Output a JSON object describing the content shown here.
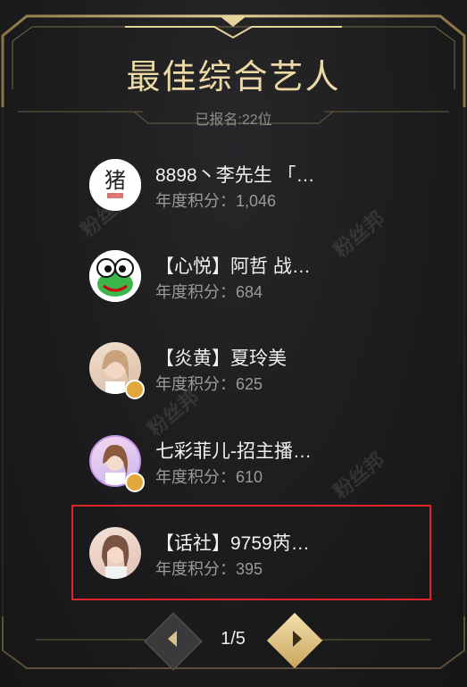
{
  "header": {
    "title": "最佳综合艺人",
    "registered": "已报名:22位"
  },
  "score_label": "年度积分：",
  "artists": [
    {
      "name": "8898丶李先生 「…",
      "score": "1,046",
      "avatar": "avatar-pig-logo"
    },
    {
      "name": "【心悦】阿哲 战…",
      "score": "684",
      "avatar": "avatar-frog"
    },
    {
      "name": "【炎黄】夏玲美",
      "score": "625",
      "avatar": "avatar-woman",
      "badge": true
    },
    {
      "name": "七彩菲儿-招主播…",
      "score": "610",
      "avatar": "avatar-woman-frame",
      "badge": true
    },
    {
      "name": "【话社】9759芮…",
      "score": "395",
      "avatar": "avatar-woman-2"
    }
  ],
  "pagination": {
    "current": "1/5",
    "prev_icon": "chevron-left-icon",
    "next_icon": "chevron-right-icon"
  },
  "watermark": "粉丝邦",
  "colors": {
    "gold": "#ecd9a6",
    "highlight": "#e0242b",
    "background": "#1b1b1d"
  }
}
